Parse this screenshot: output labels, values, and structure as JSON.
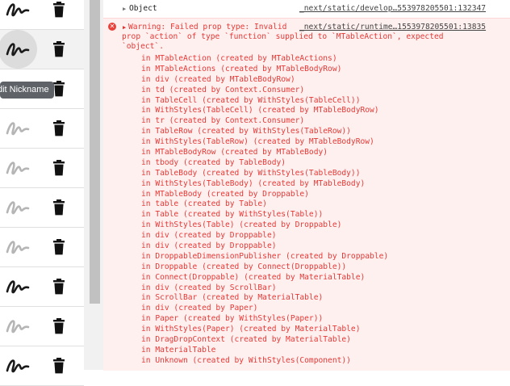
{
  "tooltip": {
    "text": "dit Nickname"
  },
  "rows": [
    {
      "signature": "dark",
      "highlighted": false
    },
    {
      "signature": "dark",
      "highlighted": true
    },
    {
      "signature": "dark",
      "highlighted": false
    },
    {
      "signature": "light",
      "highlighted": false
    },
    {
      "signature": "light",
      "highlighted": false
    },
    {
      "signature": "light",
      "highlighted": false
    },
    {
      "signature": "light",
      "highlighted": false
    },
    {
      "signature": "dark",
      "highlighted": false
    },
    {
      "signature": "light",
      "highlighted": false
    },
    {
      "signature": "dark",
      "highlighted": false
    }
  ],
  "console": {
    "object_row": {
      "label": "Object",
      "source": "_next/static/develop…553978205501:132347"
    },
    "warning": {
      "line1": "Warning: Failed prop type: Invalid",
      "line2": "prop `action` of type `function` supplied to `MTableAction`, expected",
      "line3": "`object`.",
      "source": "_next/static/runtime…1553978205501:13835",
      "stack": [
        "in MTableAction (created by MTableActions)",
        "in MTableActions (created by MTableBodyRow)",
        "in div (created by MTableBodyRow)",
        "in td (created by Context.Consumer)",
        "in TableCell (created by WithStyles(TableCell))",
        "in WithStyles(TableCell) (created by MTableBodyRow)",
        "in tr (created by Context.Consumer)",
        "in TableRow (created by WithStyles(TableRow))",
        "in WithStyles(TableRow) (created by MTableBodyRow)",
        "in MTableBodyRow (created by MTableBody)",
        "in tbody (created by TableBody)",
        "in TableBody (created by WithStyles(TableBody))",
        "in WithStyles(TableBody) (created by MTableBody)",
        "in MTableBody (created by Droppable)",
        "in table (created by Table)",
        "in Table (created by WithStyles(Table))",
        "in WithStyles(Table) (created by Droppable)",
        "in div (created by Droppable)",
        "in div (created by Droppable)",
        "in DroppableDimensionPublisher (created by Droppable)",
        "in Droppable (created by Connect(Droppable))",
        "in Connect(Droppable) (created by MaterialTable)",
        "in div (created by ScrollBar)",
        "in ScrollBar (created by MaterialTable)",
        "in div (created by Paper)",
        "in Paper (created by WithStyles(Paper))",
        "in WithStyles(Paper) (created by MaterialTable)",
        "in DragDropContext (created by MaterialTable)",
        "in MaterialTable",
        "in Unknown (created by WithStyles(Component))"
      ]
    }
  },
  "colors": {
    "error_text": "#e53935",
    "error_bg": "#fff0f0",
    "signature_dark": "#1a1a1a",
    "signature_light": "#b5b5b5"
  }
}
